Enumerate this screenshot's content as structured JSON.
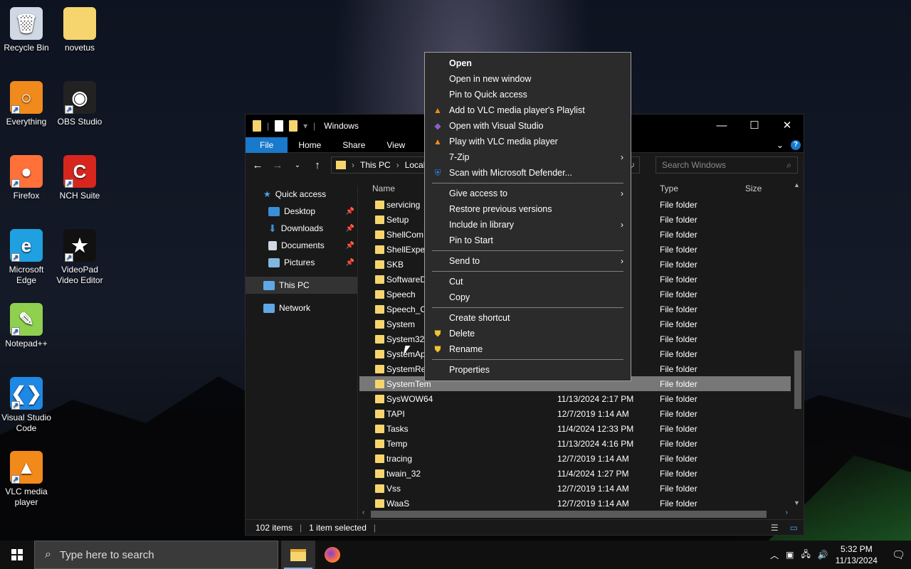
{
  "desktop": {
    "icons": [
      {
        "label": "Recycle Bin",
        "glyph": "🗑",
        "color": "#cfd8e3",
        "shortcut": false
      },
      {
        "label": "novetus",
        "glyph": "",
        "color": "#f6d56e",
        "shortcut": false
      },
      {
        "label": "Everything",
        "glyph": "○",
        "color": "#f08a1c",
        "shortcut": true
      },
      {
        "label": "OBS Studio",
        "glyph": "◉",
        "color": "#222",
        "shortcut": true
      },
      {
        "label": "Firefox",
        "glyph": "●",
        "color": "#ff7139",
        "shortcut": true
      },
      {
        "label": "NCH Suite",
        "glyph": "C",
        "color": "#d7261e",
        "shortcut": true
      },
      {
        "label": "Microsoft Edge",
        "glyph": "e",
        "color": "#1fa0e0",
        "shortcut": true
      },
      {
        "label": "VideoPad Video Editor",
        "glyph": "★",
        "color": "#111",
        "shortcut": true
      },
      {
        "label": "Notepad++",
        "glyph": "✎",
        "color": "#8fd14f",
        "shortcut": true
      },
      {
        "label": "Visual Studio Code",
        "glyph": "❮❯",
        "color": "#1e88e5",
        "shortcut": true
      },
      {
        "label": "VLC media player",
        "glyph": "▲",
        "color": "#f28a1b",
        "shortcut": true
      }
    ]
  },
  "explorer": {
    "title": "Windows",
    "ribbon_tabs": [
      "File",
      "Home",
      "Share",
      "View"
    ],
    "address": [
      "This PC",
      "Local Di"
    ],
    "search_placeholder": "Search Windows",
    "nav": {
      "quick_access": "Quick access",
      "desktop": "Desktop",
      "downloads": "Downloads",
      "documents": "Documents",
      "pictures": "Pictures",
      "this_pc": "This PC",
      "network": "Network"
    },
    "columns": {
      "name": "Name",
      "type": "Type",
      "size": "Size"
    },
    "rows": [
      {
        "name": "servicing",
        "date": "",
        "type": "File folder"
      },
      {
        "name": "Setup",
        "date": "",
        "type": "File folder"
      },
      {
        "name": "ShellCom",
        "date": "",
        "type": "File folder"
      },
      {
        "name": "ShellExpe",
        "date": "",
        "type": "File folder"
      },
      {
        "name": "SKB",
        "date": "",
        "type": "File folder"
      },
      {
        "name": "SoftwareD",
        "date": "",
        "type": "File folder"
      },
      {
        "name": "Speech",
        "date": "",
        "type": "File folder"
      },
      {
        "name": "Speech_O",
        "date": "",
        "type": "File folder"
      },
      {
        "name": "System",
        "date": "",
        "type": "File folder"
      },
      {
        "name": "System32",
        "date": "",
        "type": "File folder"
      },
      {
        "name": "SystemAp",
        "date": "",
        "type": "File folder"
      },
      {
        "name": "SystemRe",
        "date": "",
        "type": "File folder"
      },
      {
        "name": "SystemTem",
        "date": "",
        "type": "File folder",
        "selected": true
      },
      {
        "name": "SysWOW64",
        "date": "11/13/2024 2:17 PM",
        "type": "File folder"
      },
      {
        "name": "TAPI",
        "date": "12/7/2019 1:14 AM",
        "type": "File folder"
      },
      {
        "name": "Tasks",
        "date": "11/4/2024 12:33 PM",
        "type": "File folder"
      },
      {
        "name": "Temp",
        "date": "11/13/2024 4:16 PM",
        "type": "File folder"
      },
      {
        "name": "tracing",
        "date": "12/7/2019 1:14 AM",
        "type": "File folder"
      },
      {
        "name": "twain_32",
        "date": "11/4/2024 1:27 PM",
        "type": "File folder"
      },
      {
        "name": "Vss",
        "date": "12/7/2019 1:14 AM",
        "type": "File folder"
      },
      {
        "name": "WaaS",
        "date": "12/7/2019 1:14 AM",
        "type": "File folder"
      }
    ],
    "status_items": "102 items",
    "status_selected": "1 item selected"
  },
  "context_menu": {
    "groups": [
      [
        {
          "label": "Open",
          "bold": true
        },
        {
          "label": "Open in new window"
        },
        {
          "label": "Pin to Quick access"
        },
        {
          "label": "Add to VLC media player's Playlist",
          "icon": "vlc-icon"
        },
        {
          "label": "Open with Visual Studio",
          "icon": "visual-studio-icon"
        },
        {
          "label": "Play with VLC media player",
          "icon": "vlc-icon"
        },
        {
          "label": "7-Zip",
          "submenu": true
        },
        {
          "label": "Scan with Microsoft Defender...",
          "icon": "defender-shield-icon"
        }
      ],
      [
        {
          "label": "Give access to",
          "submenu": true
        },
        {
          "label": "Restore previous versions"
        },
        {
          "label": "Include in library",
          "submenu": true
        },
        {
          "label": "Pin to Start"
        }
      ],
      [
        {
          "label": "Send to",
          "submenu": true
        }
      ],
      [
        {
          "label": "Cut"
        },
        {
          "label": "Copy"
        }
      ],
      [
        {
          "label": "Create shortcut"
        },
        {
          "label": "Delete",
          "icon": "uac-shield-icon"
        },
        {
          "label": "Rename",
          "icon": "uac-shield-icon"
        }
      ],
      [
        {
          "label": "Properties"
        }
      ]
    ]
  },
  "taskbar": {
    "search_placeholder": "Type here to search",
    "time": "5:32 PM",
    "date": "11/13/2024"
  }
}
